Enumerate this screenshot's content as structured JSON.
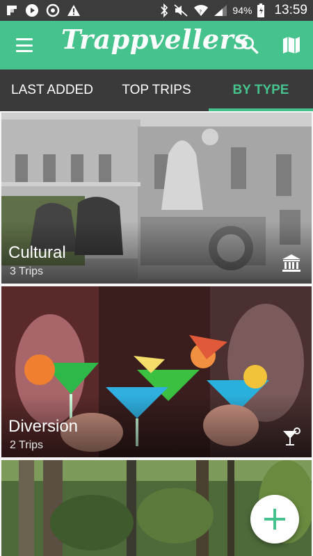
{
  "status_bar": {
    "battery_percent": "94%",
    "time": "13:59",
    "left_icons": [
      "flipboard-icon",
      "play-icon",
      "sync-icon",
      "warning-icon"
    ],
    "right_icons": [
      "bluetooth-icon",
      "mute-icon",
      "wifi-icon",
      "signal-icon",
      "battery-icon"
    ]
  },
  "app_bar": {
    "title": "Trappvellers",
    "icons": [
      "menu-icon",
      "search-icon",
      "map-icon"
    ],
    "accent_color": "#46c38c"
  },
  "tabs": [
    {
      "label": "LAST ADDED",
      "selected": false
    },
    {
      "label": "TOP TRIPS",
      "selected": false
    },
    {
      "label": "BY TYPE",
      "selected": true
    }
  ],
  "categories": [
    {
      "title": "Cultural",
      "subtitle": "3 Trips",
      "icon": "museum-icon"
    },
    {
      "title": "Diversion",
      "subtitle": "2 Trips",
      "icon": "cocktail-icon"
    },
    {
      "title": "",
      "subtitle": "",
      "icon": ""
    }
  ],
  "fab": {
    "icon": "plus-icon"
  }
}
